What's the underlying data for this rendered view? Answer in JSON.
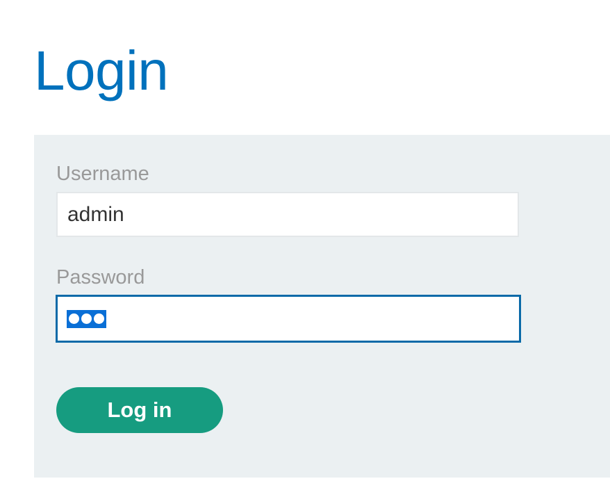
{
  "page": {
    "title": "Login"
  },
  "form": {
    "username_label": "Username",
    "username_value": "admin",
    "password_label": "Password",
    "password_masked_length": 3,
    "submit_label": "Log in"
  },
  "colors": {
    "title": "#0071bc",
    "panel_background": "#ebf0f2",
    "label": "#999999",
    "focus_border": "#0a6aa8",
    "selection": "#0a6fd6",
    "button": "#169c80"
  }
}
